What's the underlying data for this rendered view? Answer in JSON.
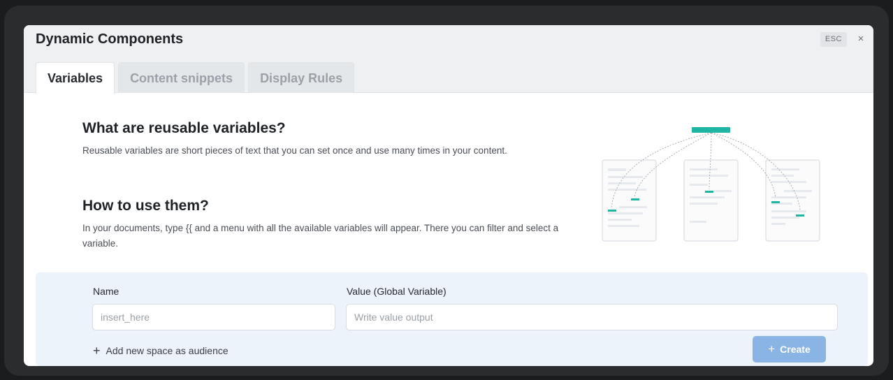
{
  "modal": {
    "title": "Dynamic Components",
    "esc_label": "ESC",
    "close_glyph": "×"
  },
  "tabs": [
    {
      "label": "Variables",
      "active": true
    },
    {
      "label": "Content snippets",
      "active": false
    },
    {
      "label": "Display Rules",
      "active": false
    }
  ],
  "info": {
    "what_title": "What are reusable variables?",
    "what_body": "Reusable variables are short pieces of text that you can set once and use many times in your content.",
    "how_title": "How to use them?",
    "how_body": "In your documents, type {{ and a menu with all the available variables will appear. There you can filter and select a variable."
  },
  "illustration": {
    "icon": "variables-diagram-illustration",
    "accent_color": "#1fb5a3"
  },
  "form": {
    "name_label": "Name",
    "name_placeholder": "insert_here",
    "value_label": "Value (Global Variable)",
    "value_placeholder": "Write value output",
    "add_audience_label": "Add new space as audience",
    "create_label": "Create",
    "plus_glyph": "+"
  },
  "colors": {
    "primary_button": "#8ab4e4",
    "form_background": "#edf3fb"
  }
}
